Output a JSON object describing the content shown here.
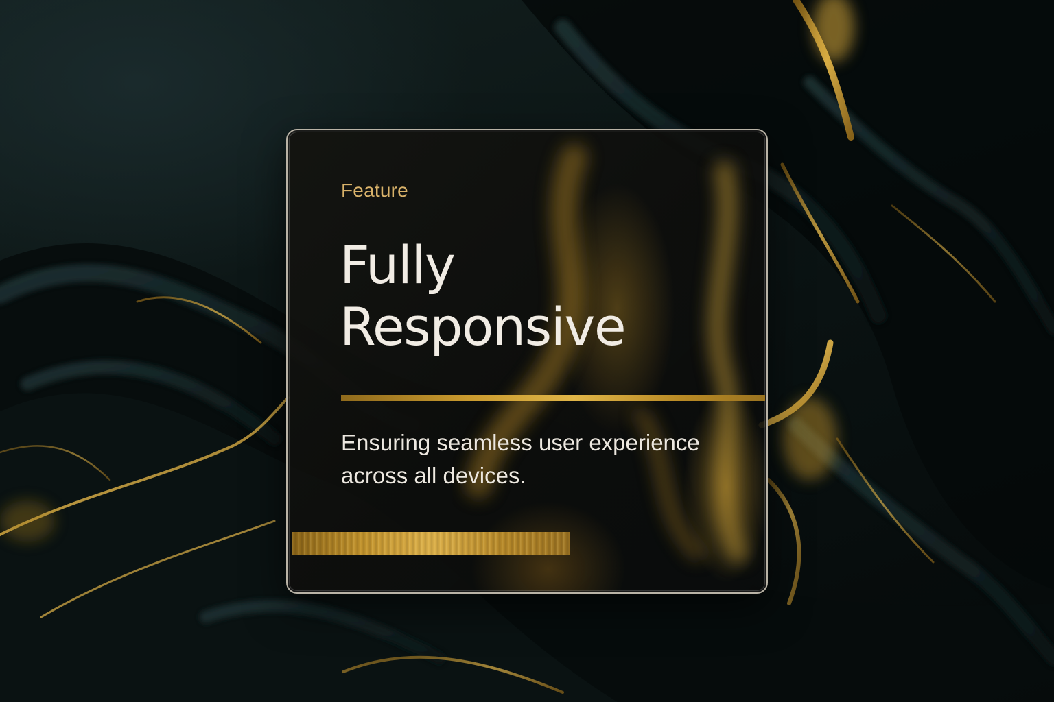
{
  "card": {
    "eyebrow": "Feature",
    "title_line1": "Fully",
    "title_line2": "Responsive",
    "description": "Ensuring seamless user experience across all devices."
  },
  "colors": {
    "accent_gold": "#d9b26a",
    "gold_bar": "#c1922c",
    "text_light": "#f1ece4",
    "background": "#0b1414"
  }
}
